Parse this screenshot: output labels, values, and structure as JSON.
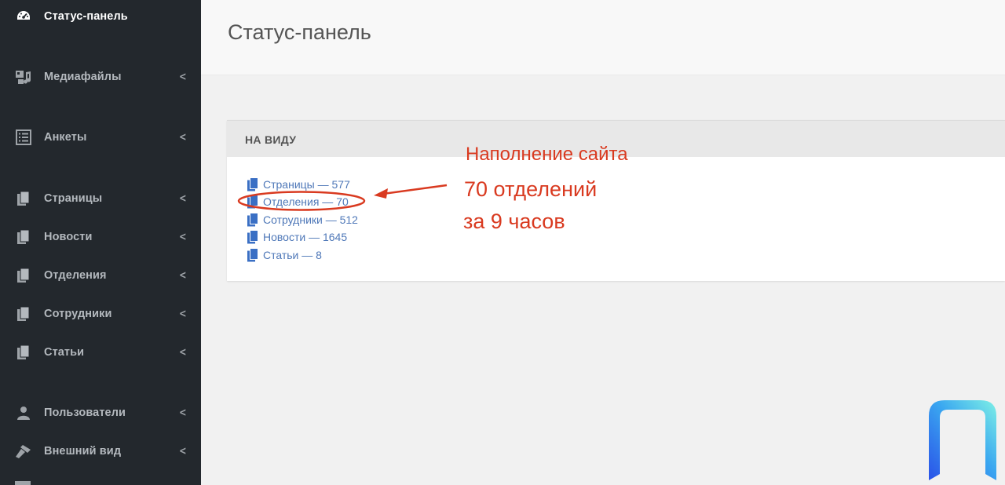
{
  "sidebar": {
    "items": [
      {
        "label": "Статус-панель",
        "icon": "dashboard-icon",
        "active": true,
        "chevron": false
      },
      {
        "label": "Медиафайлы",
        "icon": "media-icon",
        "chevron": true
      },
      {
        "label": "Анкеты",
        "icon": "list-icon",
        "chevron": true
      },
      {
        "label": "Страницы",
        "icon": "pages-icon",
        "chevron": true
      },
      {
        "label": "Новости",
        "icon": "pages-icon",
        "chevron": true
      },
      {
        "label": "Отделения",
        "icon": "pages-icon",
        "chevron": true
      },
      {
        "label": "Сотрудники",
        "icon": "pages-icon",
        "chevron": true
      },
      {
        "label": "Статьи",
        "icon": "pages-icon",
        "chevron": true
      },
      {
        "label": "Пользователи",
        "icon": "user-icon",
        "chevron": true
      },
      {
        "label": "Внешний вид",
        "icon": "brush-icon",
        "chevron": true
      }
    ],
    "chevron_glyph": "<"
  },
  "header": {
    "title": "Статус-панель"
  },
  "widget": {
    "title": "НА ВИДУ",
    "links": [
      {
        "text": "Страницы — 577"
      },
      {
        "text": "Отделения — 70"
      },
      {
        "text": "Сотрудники — 512"
      },
      {
        "text": "Новости — 1645"
      },
      {
        "text": "Статьи — 8"
      }
    ]
  },
  "annotation": {
    "line1": "Наполнение сайта",
    "line2": "70 отделений",
    "line3": "за 9 часов",
    "color": "#d93a20"
  },
  "colors": {
    "sidebar_bg": "#23282d",
    "link": "#4f78b8",
    "icon_blue": "#3a6fc4"
  }
}
